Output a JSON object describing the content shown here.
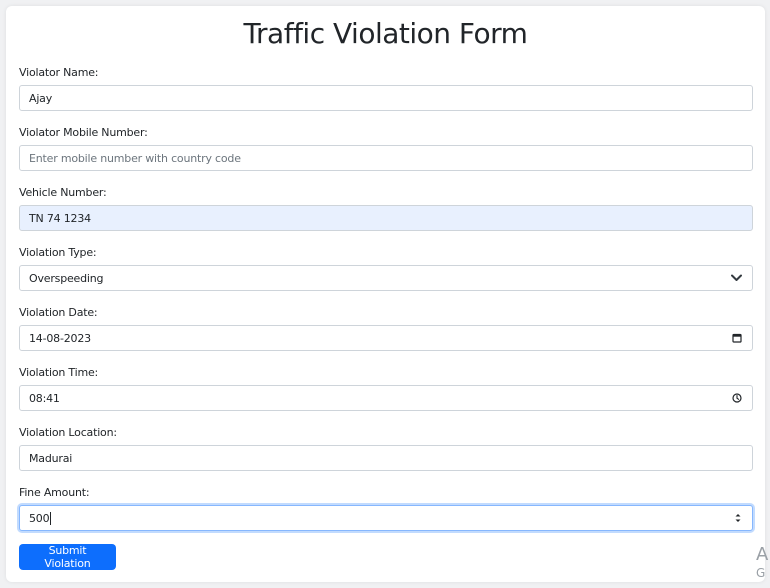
{
  "form": {
    "title": "Traffic Violation Form",
    "violator_name": {
      "label": "Violator Name:",
      "value": "Ajay"
    },
    "violator_mobile": {
      "label": "Violator Mobile Number:",
      "placeholder": "Enter mobile number with country code"
    },
    "vehicle_number": {
      "label": "Vehicle Number:",
      "value": "TN 74 1234"
    },
    "violation_type": {
      "label": "Violation Type:",
      "value": "Overspeeding"
    },
    "violation_date": {
      "label": "Violation Date:",
      "value": "14-08-2023"
    },
    "violation_time": {
      "label": "Violation Time:",
      "value": "08:41"
    },
    "violation_location": {
      "label": "Violation Location:",
      "value": "Madurai"
    },
    "fine_amount": {
      "label": "Fine Amount:",
      "value": "500"
    },
    "submit_label": "Submit Violation"
  },
  "corner": {
    "line1": "A",
    "line2": "G"
  },
  "icons": {
    "select": "chevron-down-icon",
    "date": "calendar-icon",
    "time": "clock-icon",
    "number": "spinner-icon"
  },
  "colors": {
    "accent": "#0d6efd",
    "autofill": "#e8f0fe",
    "focus_border": "#86b7fe"
  }
}
